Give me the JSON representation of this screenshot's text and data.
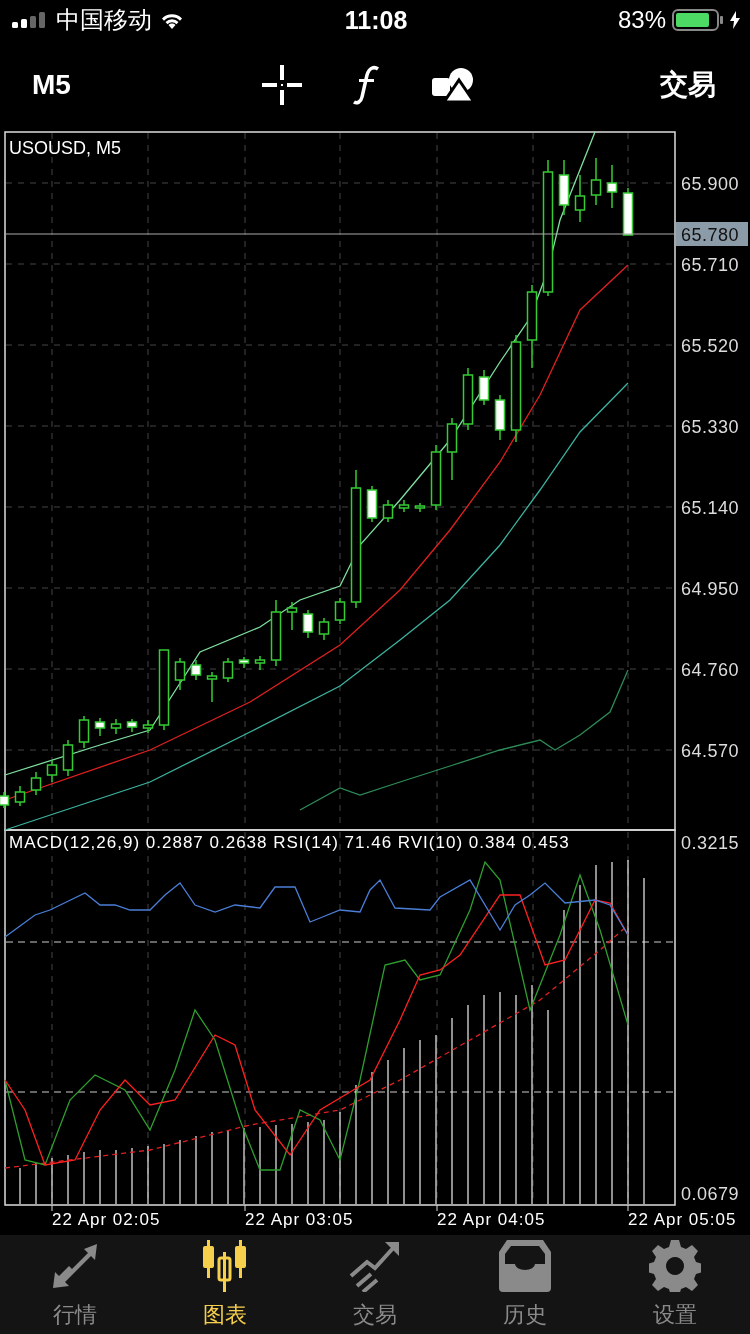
{
  "status_bar": {
    "carrier": "中国移动",
    "time": "11:08",
    "battery_percent": "83%"
  },
  "toolbar": {
    "timeframe": "M5",
    "trade_button": "交易"
  },
  "chart": {
    "symbol_label": "USOUSD, M5",
    "price_ticks": [
      "65.900",
      "65.710",
      "65.520",
      "65.330",
      "65.140",
      "64.950",
      "64.760",
      "64.570"
    ],
    "current_price": "65.780",
    "indicator_label": "MACD(12,26,9) 0.2887 0.2638 RSI(14) 71.46 RVI(10) 0.384 0.453",
    "indicator_ticks": [
      "0.3215",
      "0.0679"
    ],
    "time_labels": [
      "22 Apr 02:05",
      "22 Apr 03:05",
      "22 Apr 04:05",
      "22 Apr 05:05"
    ]
  },
  "tab_bar": {
    "items": [
      {
        "label": "行情",
        "selected": false
      },
      {
        "label": "图表",
        "selected": true
      },
      {
        "label": "交易",
        "selected": false
      },
      {
        "label": "历史",
        "selected": false
      },
      {
        "label": "设置",
        "selected": false
      }
    ]
  }
}
